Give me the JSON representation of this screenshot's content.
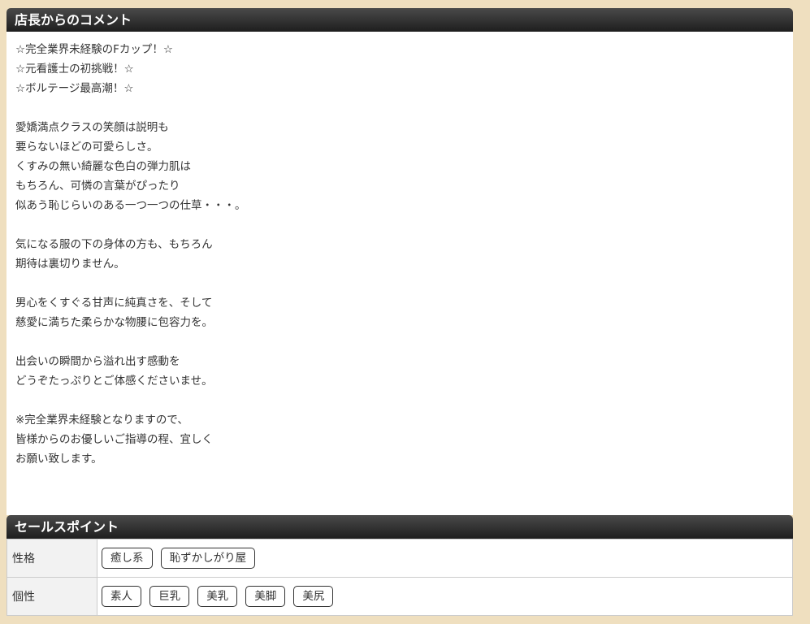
{
  "comment_section": {
    "title": "店長からのコメント",
    "lines": [
      "☆完全業界未経験のFカップ！☆",
      "☆元看護士の初挑戦！☆",
      "☆ボルテージ最高潮！☆",
      "",
      "愛嬌満点クラスの笑顔は説明も",
      "要らないほどの可愛らしさ。",
      "くすみの無い綺麗な色白の弾力肌は",
      "もちろん、可憐の言葉がぴったり",
      "似あう恥じらいのある一つ一つの仕草・・・。",
      "",
      "気になる服の下の身体の方も、もちろん",
      "期待は裏切りません。",
      "",
      "男心をくすぐる甘声に純真さを、そして",
      "慈愛に満ちた柔らかな物腰に包容力を。",
      "",
      "出会いの瞬間から溢れ出す感動を",
      "どうぞたっぷりとご体感くださいませ。",
      "",
      "※完全業界未経験となりますので、",
      "皆様からのお優しいご指導の程、宜しく",
      "お願い致します。"
    ]
  },
  "sales_section": {
    "title": "セールスポイント",
    "rows": [
      {
        "label": "性格",
        "tags": [
          "癒し系",
          "恥ずかしがり屋"
        ]
      },
      {
        "label": "個性",
        "tags": [
          "素人",
          "巨乳",
          "美乳",
          "美脚",
          "美尻"
        ]
      }
    ]
  }
}
